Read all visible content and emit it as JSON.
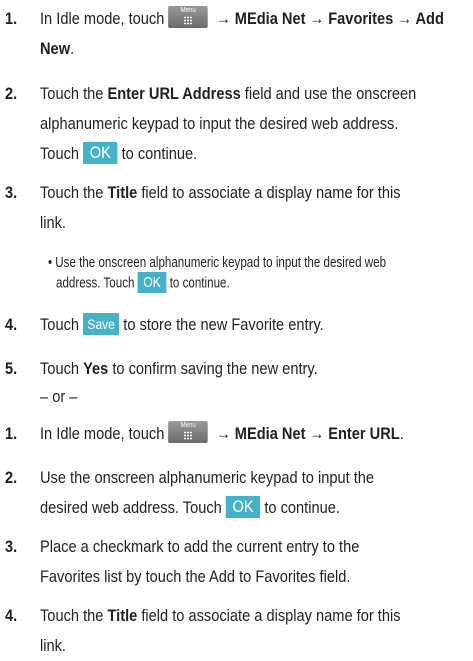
{
  "buttons": {
    "menu_label": "Menu",
    "ok_label": "OK",
    "save_label": "Save"
  },
  "arrow": "→",
  "separator": "– or –",
  "steps": [
    {
      "num": "1.",
      "prefix": "In Idle mode, touch",
      "path": [
        "MEdia Net",
        "Favorites",
        "Add"
      ],
      "cont": "New",
      "end": "."
    },
    {
      "num": "2.",
      "a": "Touch the ",
      "bold": "Enter URL Address",
      "b": " field and use the onscreen",
      "line2": "alphanumeric keypad to input the desired web address.",
      "line3a": "Touch",
      "line3b": "to continue."
    },
    {
      "num": "3.",
      "a": "Touch the ",
      "bold": "Title",
      "b": " field to associate a display name for this",
      "line2": "link.",
      "bullet_line1": "• Use the onscreen alphanumeric keypad to input the desired web",
      "bullet_line2a": "address. Touch",
      "bullet_line2b": "to continue."
    },
    {
      "num": "4.",
      "a": "Touch",
      "b": "to store the new Favorite entry."
    },
    {
      "num": "5.",
      "a": "Touch ",
      "bold": "Yes",
      "b": " to confirm saving the new entry."
    }
  ],
  "steps2": [
    {
      "num": "1.",
      "prefix": "In Idle mode, touch",
      "path": [
        "MEdia Net",
        "Enter URL"
      ],
      "end": "."
    },
    {
      "num": "2.",
      "line1": "Use the onscreen alphanumeric keypad to input the",
      "line2a": "desired web address. Touch",
      "line2b": "to continue."
    },
    {
      "num": "3.",
      "line1": "Place a checkmark to add the current entry to the",
      "line2": "Favorites list by touch the Add to Favorites field."
    },
    {
      "num": "4.",
      "a": "Touch the ",
      "bold": "Title",
      "b": " field to associate a display name for this",
      "line2": "link."
    }
  ]
}
